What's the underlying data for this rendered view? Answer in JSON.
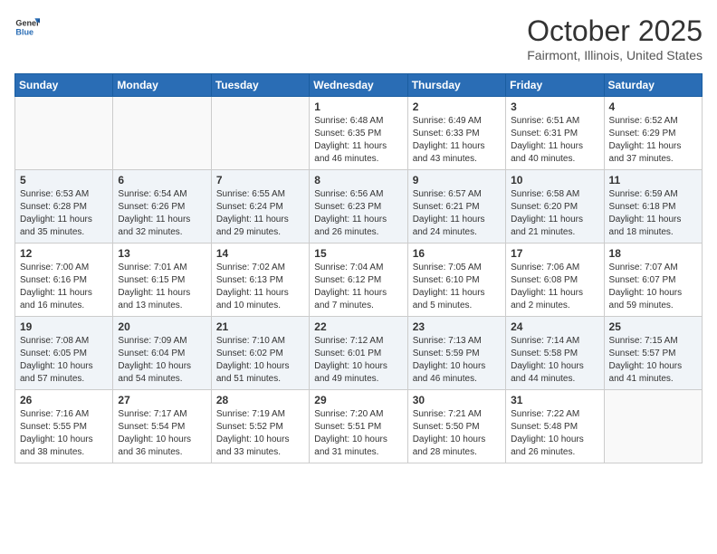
{
  "header": {
    "logo_general": "General",
    "logo_blue": "Blue",
    "month": "October 2025",
    "location": "Fairmont, Illinois, United States"
  },
  "days_of_week": [
    "Sunday",
    "Monday",
    "Tuesday",
    "Wednesday",
    "Thursday",
    "Friday",
    "Saturday"
  ],
  "weeks": [
    [
      {
        "day": "",
        "content": ""
      },
      {
        "day": "",
        "content": ""
      },
      {
        "day": "",
        "content": ""
      },
      {
        "day": "1",
        "content": "Sunrise: 6:48 AM\nSunset: 6:35 PM\nDaylight: 11 hours and 46 minutes."
      },
      {
        "day": "2",
        "content": "Sunrise: 6:49 AM\nSunset: 6:33 PM\nDaylight: 11 hours and 43 minutes."
      },
      {
        "day": "3",
        "content": "Sunrise: 6:51 AM\nSunset: 6:31 PM\nDaylight: 11 hours and 40 minutes."
      },
      {
        "day": "4",
        "content": "Sunrise: 6:52 AM\nSunset: 6:29 PM\nDaylight: 11 hours and 37 minutes."
      }
    ],
    [
      {
        "day": "5",
        "content": "Sunrise: 6:53 AM\nSunset: 6:28 PM\nDaylight: 11 hours and 35 minutes."
      },
      {
        "day": "6",
        "content": "Sunrise: 6:54 AM\nSunset: 6:26 PM\nDaylight: 11 hours and 32 minutes."
      },
      {
        "day": "7",
        "content": "Sunrise: 6:55 AM\nSunset: 6:24 PM\nDaylight: 11 hours and 29 minutes."
      },
      {
        "day": "8",
        "content": "Sunrise: 6:56 AM\nSunset: 6:23 PM\nDaylight: 11 hours and 26 minutes."
      },
      {
        "day": "9",
        "content": "Sunrise: 6:57 AM\nSunset: 6:21 PM\nDaylight: 11 hours and 24 minutes."
      },
      {
        "day": "10",
        "content": "Sunrise: 6:58 AM\nSunset: 6:20 PM\nDaylight: 11 hours and 21 minutes."
      },
      {
        "day": "11",
        "content": "Sunrise: 6:59 AM\nSunset: 6:18 PM\nDaylight: 11 hours and 18 minutes."
      }
    ],
    [
      {
        "day": "12",
        "content": "Sunrise: 7:00 AM\nSunset: 6:16 PM\nDaylight: 11 hours and 16 minutes."
      },
      {
        "day": "13",
        "content": "Sunrise: 7:01 AM\nSunset: 6:15 PM\nDaylight: 11 hours and 13 minutes."
      },
      {
        "day": "14",
        "content": "Sunrise: 7:02 AM\nSunset: 6:13 PM\nDaylight: 11 hours and 10 minutes."
      },
      {
        "day": "15",
        "content": "Sunrise: 7:04 AM\nSunset: 6:12 PM\nDaylight: 11 hours and 7 minutes."
      },
      {
        "day": "16",
        "content": "Sunrise: 7:05 AM\nSunset: 6:10 PM\nDaylight: 11 hours and 5 minutes."
      },
      {
        "day": "17",
        "content": "Sunrise: 7:06 AM\nSunset: 6:08 PM\nDaylight: 11 hours and 2 minutes."
      },
      {
        "day": "18",
        "content": "Sunrise: 7:07 AM\nSunset: 6:07 PM\nDaylight: 10 hours and 59 minutes."
      }
    ],
    [
      {
        "day": "19",
        "content": "Sunrise: 7:08 AM\nSunset: 6:05 PM\nDaylight: 10 hours and 57 minutes."
      },
      {
        "day": "20",
        "content": "Sunrise: 7:09 AM\nSunset: 6:04 PM\nDaylight: 10 hours and 54 minutes."
      },
      {
        "day": "21",
        "content": "Sunrise: 7:10 AM\nSunset: 6:02 PM\nDaylight: 10 hours and 51 minutes."
      },
      {
        "day": "22",
        "content": "Sunrise: 7:12 AM\nSunset: 6:01 PM\nDaylight: 10 hours and 49 minutes."
      },
      {
        "day": "23",
        "content": "Sunrise: 7:13 AM\nSunset: 5:59 PM\nDaylight: 10 hours and 46 minutes."
      },
      {
        "day": "24",
        "content": "Sunrise: 7:14 AM\nSunset: 5:58 PM\nDaylight: 10 hours and 44 minutes."
      },
      {
        "day": "25",
        "content": "Sunrise: 7:15 AM\nSunset: 5:57 PM\nDaylight: 10 hours and 41 minutes."
      }
    ],
    [
      {
        "day": "26",
        "content": "Sunrise: 7:16 AM\nSunset: 5:55 PM\nDaylight: 10 hours and 38 minutes."
      },
      {
        "day": "27",
        "content": "Sunrise: 7:17 AM\nSunset: 5:54 PM\nDaylight: 10 hours and 36 minutes."
      },
      {
        "day": "28",
        "content": "Sunrise: 7:19 AM\nSunset: 5:52 PM\nDaylight: 10 hours and 33 minutes."
      },
      {
        "day": "29",
        "content": "Sunrise: 7:20 AM\nSunset: 5:51 PM\nDaylight: 10 hours and 31 minutes."
      },
      {
        "day": "30",
        "content": "Sunrise: 7:21 AM\nSunset: 5:50 PM\nDaylight: 10 hours and 28 minutes."
      },
      {
        "day": "31",
        "content": "Sunrise: 7:22 AM\nSunset: 5:48 PM\nDaylight: 10 hours and 26 minutes."
      },
      {
        "day": "",
        "content": ""
      }
    ]
  ]
}
